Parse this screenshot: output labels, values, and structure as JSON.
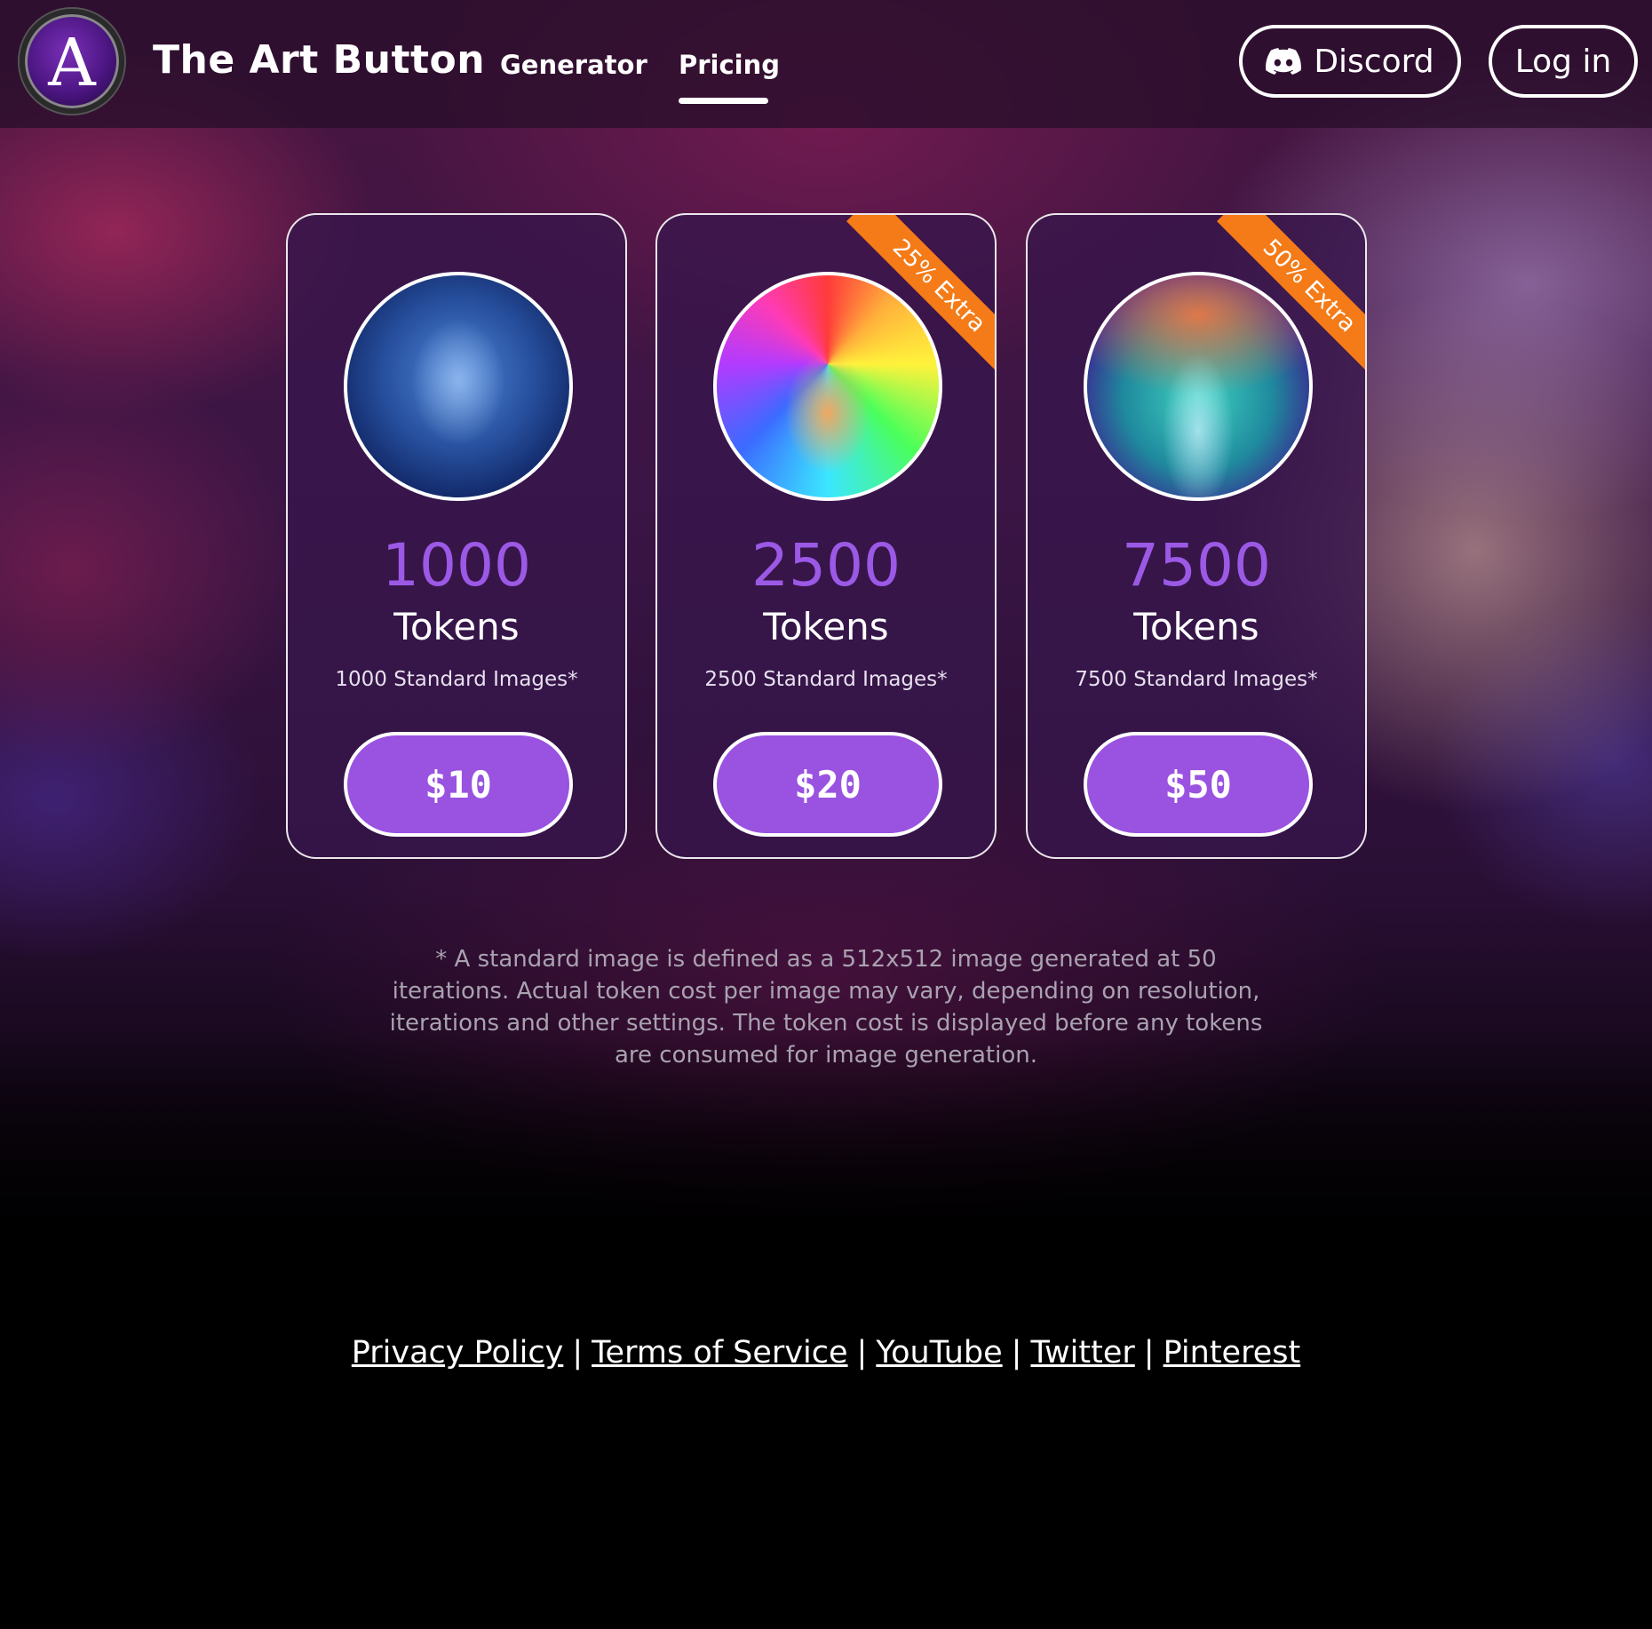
{
  "header": {
    "logo_letter": "A",
    "brand": "The Art Button",
    "nav": [
      {
        "label": "Generator",
        "active": false
      },
      {
        "label": "Pricing",
        "active": true
      }
    ],
    "discord_label": "Discord",
    "login_label": "Log in"
  },
  "pricing": {
    "cards": [
      {
        "amount": "1000",
        "unit": "Tokens",
        "description": "1000 Standard Images*",
        "price": "$10",
        "ribbon": "",
        "image_icon": "glass-face-portrait"
      },
      {
        "amount": "2500",
        "unit": "Tokens",
        "description": "2500 Standard Images*",
        "price": "$20",
        "ribbon": "25% Extra",
        "image_icon": "rainbow-face-portrait"
      },
      {
        "amount": "7500",
        "unit": "Tokens",
        "description": "7500 Standard Images*",
        "price": "$50",
        "ribbon": "50% Extra",
        "image_icon": "cosmic-mind-portrait"
      }
    ]
  },
  "footnote": "* A standard image is defined as a 512x512 image generated at 50 iterations. Actual token cost per image may vary, depending on resolution, iterations and other settings. The token cost is displayed before any tokens are consumed for image generation.",
  "footer": {
    "links": [
      "Privacy Policy",
      "Terms of Service",
      "YouTube",
      "Twitter",
      "Pinterest"
    ],
    "separator": "|"
  },
  "colors": {
    "accent": "#9a52e0",
    "amount_text": "#9b59e6",
    "ribbon": "#f47b17",
    "header_bg": "#2a0e2c"
  }
}
